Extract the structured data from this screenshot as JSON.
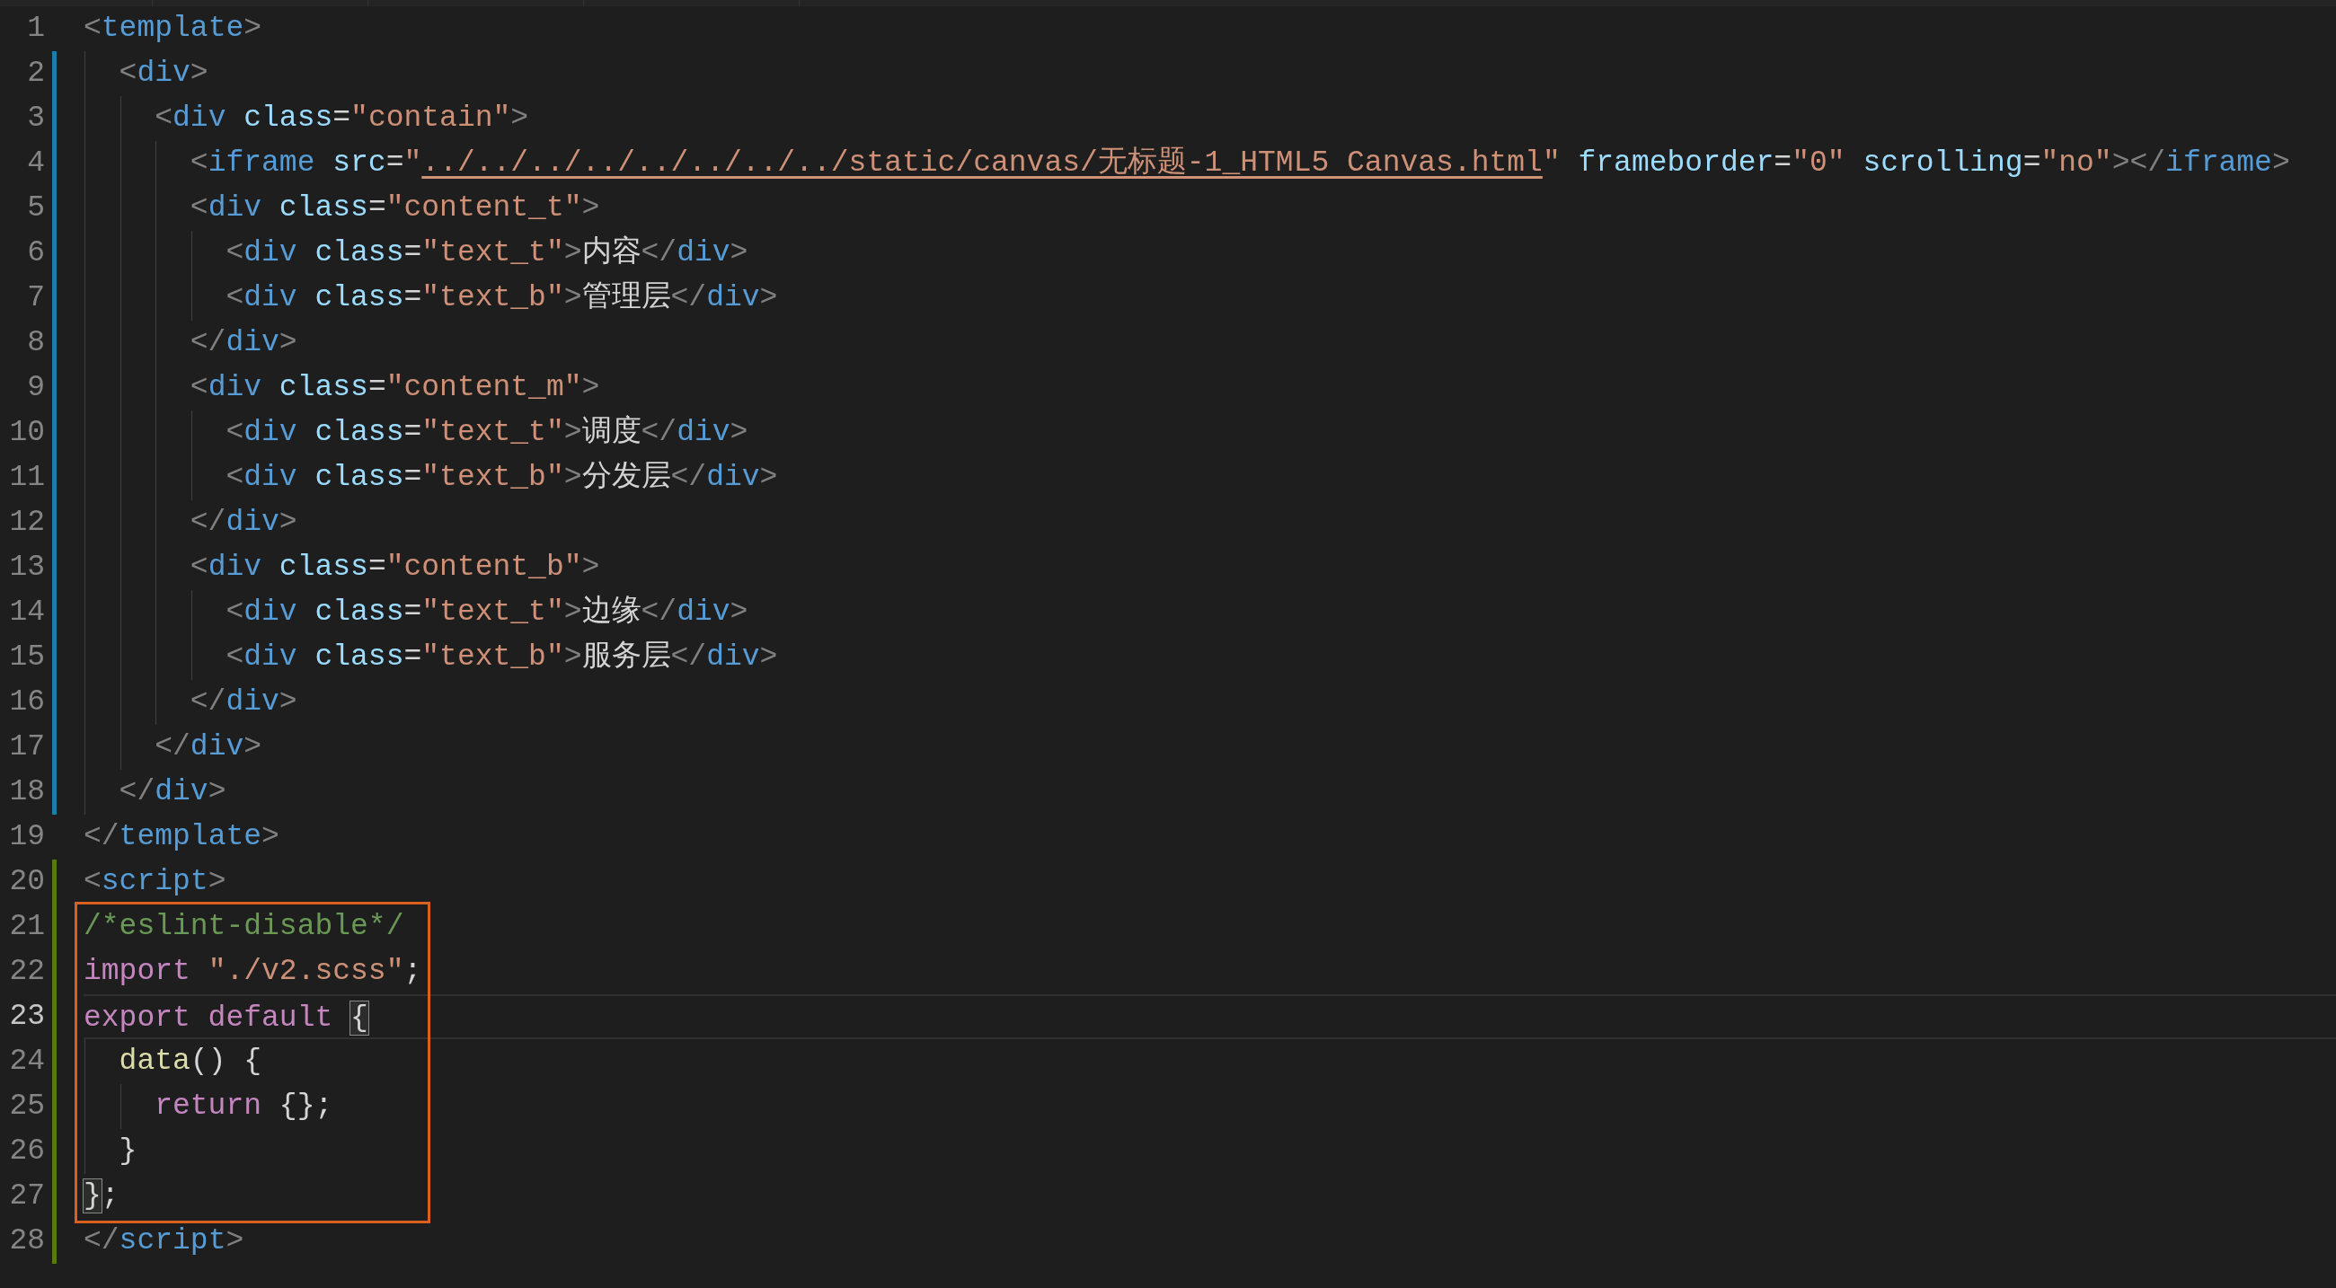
{
  "blocks": [
    {
      "framed": false,
      "lines": [
        {
          "number": "1",
          "modified": false,
          "added": false,
          "current": false,
          "tokens": [
            {
              "kind": "punct",
              "text": "<"
            },
            {
              "kind": "tag",
              "text": "template"
            },
            {
              "kind": "punct",
              "text": ">"
            }
          ]
        },
        {
          "number": "2",
          "modified": true,
          "added": false,
          "current": false,
          "tokens": [
            {
              "kind": "punct",
              "text": "  <"
            },
            {
              "kind": "tag",
              "text": "div"
            },
            {
              "kind": "punct",
              "text": ">"
            }
          ]
        },
        {
          "number": "3",
          "modified": true,
          "added": false,
          "current": false,
          "tokens": [
            {
              "kind": "punct",
              "text": "    <"
            },
            {
              "kind": "tag",
              "text": "div"
            },
            {
              "kind": "attr",
              "text": " class"
            },
            {
              "kind": "plain",
              "text": "="
            },
            {
              "kind": "string",
              "text": "\"contain\""
            },
            {
              "kind": "punct",
              "text": ">"
            }
          ]
        },
        {
          "number": "4",
          "modified": true,
          "added": false,
          "current": false,
          "tokens": [
            {
              "kind": "punct",
              "text": "      <"
            },
            {
              "kind": "tag",
              "text": "iframe"
            },
            {
              "kind": "attr",
              "text": " src"
            },
            {
              "kind": "plain",
              "text": "="
            },
            {
              "kind": "string",
              "text": "\""
            },
            {
              "kind": "link",
              "text": "../../../../../../../../static/canvas/无标题-1_HTML5 Canvas.html"
            },
            {
              "kind": "string",
              "text": "\""
            },
            {
              "kind": "attr",
              "text": " frameborder"
            },
            {
              "kind": "plain",
              "text": "="
            },
            {
              "kind": "string",
              "text": "\"0\""
            },
            {
              "kind": "attr",
              "text": " scrolling"
            },
            {
              "kind": "plain",
              "text": "="
            },
            {
              "kind": "string",
              "text": "\"no\""
            },
            {
              "kind": "punct",
              "text": "></"
            },
            {
              "kind": "tag",
              "text": "iframe"
            },
            {
              "kind": "punct",
              "text": ">"
            }
          ]
        },
        {
          "number": "5",
          "modified": true,
          "added": false,
          "current": false,
          "tokens": [
            {
              "kind": "punct",
              "text": "      <"
            },
            {
              "kind": "tag",
              "text": "div"
            },
            {
              "kind": "attr",
              "text": " class"
            },
            {
              "kind": "plain",
              "text": "="
            },
            {
              "kind": "string",
              "text": "\"content_t\""
            },
            {
              "kind": "punct",
              "text": ">"
            }
          ]
        },
        {
          "number": "6",
          "modified": true,
          "added": false,
          "current": false,
          "tokens": [
            {
              "kind": "punct",
              "text": "        <"
            },
            {
              "kind": "tag",
              "text": "div"
            },
            {
              "kind": "attr",
              "text": " class"
            },
            {
              "kind": "plain",
              "text": "="
            },
            {
              "kind": "string",
              "text": "\"text_t\""
            },
            {
              "kind": "punct",
              "text": ">"
            },
            {
              "kind": "plain",
              "text": "内容"
            },
            {
              "kind": "punct",
              "text": "</"
            },
            {
              "kind": "tag",
              "text": "div"
            },
            {
              "kind": "punct",
              "text": ">"
            }
          ]
        },
        {
          "number": "7",
          "modified": true,
          "added": false,
          "current": false,
          "tokens": [
            {
              "kind": "punct",
              "text": "        <"
            },
            {
              "kind": "tag",
              "text": "div"
            },
            {
              "kind": "attr",
              "text": " class"
            },
            {
              "kind": "plain",
              "text": "="
            },
            {
              "kind": "string",
              "text": "\"text_b\""
            },
            {
              "kind": "punct",
              "text": ">"
            },
            {
              "kind": "plain",
              "text": "管理层"
            },
            {
              "kind": "punct",
              "text": "</"
            },
            {
              "kind": "tag",
              "text": "div"
            },
            {
              "kind": "punct",
              "text": ">"
            }
          ]
        },
        {
          "number": "8",
          "modified": true,
          "added": false,
          "current": false,
          "tokens": [
            {
              "kind": "punct",
              "text": "      </"
            },
            {
              "kind": "tag",
              "text": "div"
            },
            {
              "kind": "punct",
              "text": ">"
            }
          ]
        },
        {
          "number": "9",
          "modified": true,
          "added": false,
          "current": false,
          "tokens": [
            {
              "kind": "punct",
              "text": "      <"
            },
            {
              "kind": "tag",
              "text": "div"
            },
            {
              "kind": "attr",
              "text": " class"
            },
            {
              "kind": "plain",
              "text": "="
            },
            {
              "kind": "string",
              "text": "\"content_m\""
            },
            {
              "kind": "punct",
              "text": ">"
            }
          ]
        },
        {
          "number": "10",
          "modified": true,
          "added": false,
          "current": false,
          "tokens": [
            {
              "kind": "punct",
              "text": "        <"
            },
            {
              "kind": "tag",
              "text": "div"
            },
            {
              "kind": "attr",
              "text": " class"
            },
            {
              "kind": "plain",
              "text": "="
            },
            {
              "kind": "string",
              "text": "\"text_t\""
            },
            {
              "kind": "punct",
              "text": ">"
            },
            {
              "kind": "plain",
              "text": "调度"
            },
            {
              "kind": "punct",
              "text": "</"
            },
            {
              "kind": "tag",
              "text": "div"
            },
            {
              "kind": "punct",
              "text": ">"
            }
          ]
        },
        {
          "number": "11",
          "modified": true,
          "added": false,
          "current": false,
          "tokens": [
            {
              "kind": "punct",
              "text": "        <"
            },
            {
              "kind": "tag",
              "text": "div"
            },
            {
              "kind": "attr",
              "text": " class"
            },
            {
              "kind": "plain",
              "text": "="
            },
            {
              "kind": "string",
              "text": "\"text_b\""
            },
            {
              "kind": "punct",
              "text": ">"
            },
            {
              "kind": "plain",
              "text": "分发层"
            },
            {
              "kind": "punct",
              "text": "</"
            },
            {
              "kind": "tag",
              "text": "div"
            },
            {
              "kind": "punct",
              "text": ">"
            }
          ]
        },
        {
          "number": "12",
          "modified": true,
          "added": false,
          "current": false,
          "tokens": [
            {
              "kind": "punct",
              "text": "      </"
            },
            {
              "kind": "tag",
              "text": "div"
            },
            {
              "kind": "punct",
              "text": ">"
            }
          ]
        },
        {
          "number": "13",
          "modified": true,
          "added": false,
          "current": false,
          "tokens": [
            {
              "kind": "punct",
              "text": "      <"
            },
            {
              "kind": "tag",
              "text": "div"
            },
            {
              "kind": "attr",
              "text": " class"
            },
            {
              "kind": "plain",
              "text": "="
            },
            {
              "kind": "string",
              "text": "\"content_b\""
            },
            {
              "kind": "punct",
              "text": ">"
            }
          ]
        },
        {
          "number": "14",
          "modified": true,
          "added": false,
          "current": false,
          "tokens": [
            {
              "kind": "punct",
              "text": "        <"
            },
            {
              "kind": "tag",
              "text": "div"
            },
            {
              "kind": "attr",
              "text": " class"
            },
            {
              "kind": "plain",
              "text": "="
            },
            {
              "kind": "string",
              "text": "\"text_t\""
            },
            {
              "kind": "punct",
              "text": ">"
            },
            {
              "kind": "plain",
              "text": "边缘"
            },
            {
              "kind": "punct",
              "text": "</"
            },
            {
              "kind": "tag",
              "text": "div"
            },
            {
              "kind": "punct",
              "text": ">"
            }
          ]
        },
        {
          "number": "15",
          "modified": true,
          "added": false,
          "current": false,
          "tokens": [
            {
              "kind": "punct",
              "text": "        <"
            },
            {
              "kind": "tag",
              "text": "div"
            },
            {
              "kind": "attr",
              "text": " class"
            },
            {
              "kind": "plain",
              "text": "="
            },
            {
              "kind": "string",
              "text": "\"text_b\""
            },
            {
              "kind": "punct",
              "text": ">"
            },
            {
              "kind": "plain",
              "text": "服务层"
            },
            {
              "kind": "punct",
              "text": "</"
            },
            {
              "kind": "tag",
              "text": "div"
            },
            {
              "kind": "punct",
              "text": ">"
            }
          ]
        },
        {
          "number": "16",
          "modified": true,
          "added": false,
          "current": false,
          "tokens": [
            {
              "kind": "punct",
              "text": "      </"
            },
            {
              "kind": "tag",
              "text": "div"
            },
            {
              "kind": "punct",
              "text": ">"
            }
          ]
        },
        {
          "number": "17",
          "modified": true,
          "added": false,
          "current": false,
          "tokens": [
            {
              "kind": "punct",
              "text": "    </"
            },
            {
              "kind": "tag",
              "text": "div"
            },
            {
              "kind": "punct",
              "text": ">"
            }
          ]
        },
        {
          "number": "18",
          "modified": true,
          "added": false,
          "current": false,
          "tokens": [
            {
              "kind": "punct",
              "text": "  </"
            },
            {
              "kind": "tag",
              "text": "div"
            },
            {
              "kind": "punct",
              "text": ">"
            }
          ]
        },
        {
          "number": "19",
          "modified": false,
          "added": false,
          "current": false,
          "tokens": [
            {
              "kind": "punct",
              "text": "</"
            },
            {
              "kind": "tag",
              "text": "template"
            },
            {
              "kind": "punct",
              "text": ">"
            }
          ]
        },
        {
          "number": "20",
          "modified": false,
          "added": true,
          "current": false,
          "tokens": [
            {
              "kind": "punct",
              "text": "<"
            },
            {
              "kind": "tag",
              "text": "script"
            },
            {
              "kind": "punct",
              "text": ">"
            }
          ]
        }
      ]
    },
    {
      "framed": true,
      "lines": [
        {
          "number": "21",
          "modified": false,
          "added": true,
          "current": false,
          "tokens": [
            {
              "kind": "comment",
              "text": "/*eslint-disable*/"
            }
          ]
        },
        {
          "number": "22",
          "modified": false,
          "added": true,
          "current": false,
          "tokens": [
            {
              "kind": "keyword",
              "text": "import"
            },
            {
              "kind": "string",
              "text": " \"./v2.scss\""
            },
            {
              "kind": "plain",
              "text": ";"
            }
          ]
        },
        {
          "number": "23",
          "modified": false,
          "added": true,
          "current": true,
          "tokens": [
            {
              "kind": "keyword",
              "text": "export default "
            },
            {
              "kind": "bracket",
              "text": "{"
            }
          ]
        },
        {
          "number": "24",
          "modified": false,
          "added": true,
          "current": false,
          "tokens": [
            {
              "kind": "func",
              "text": "  data"
            },
            {
              "kind": "plain",
              "text": "() {"
            }
          ]
        },
        {
          "number": "25",
          "modified": false,
          "added": true,
          "current": false,
          "tokens": [
            {
              "kind": "keyword",
              "text": "    return"
            },
            {
              "kind": "plain",
              "text": " {};"
            }
          ]
        },
        {
          "number": "26",
          "modified": false,
          "added": true,
          "current": false,
          "tokens": [
            {
              "kind": "plain",
              "text": "  }"
            }
          ]
        },
        {
          "number": "27",
          "modified": false,
          "added": true,
          "current": false,
          "tokens": [
            {
              "kind": "bracket",
              "text": "}"
            },
            {
              "kind": "plain",
              "text": ";"
            }
          ]
        }
      ]
    },
    {
      "framed": false,
      "lines": [
        {
          "number": "28",
          "modified": false,
          "added": true,
          "current": false,
          "tokens": [
            {
              "kind": "punct",
              "text": "</"
            },
            {
              "kind": "tag",
              "text": "script"
            },
            {
              "kind": "punct",
              "text": ">"
            }
          ]
        }
      ]
    }
  ]
}
